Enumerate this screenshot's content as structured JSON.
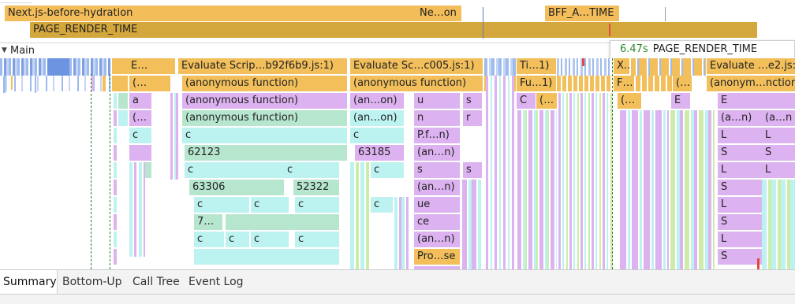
{
  "tooltip": {
    "time": "6.47s",
    "label": "PAGE_RENDER_TIME"
  },
  "main_track_label": "Main",
  "timings": [
    {
      "label": "Next.js-before-hydration"
    },
    {
      "label": "Ne…on"
    },
    {
      "label": "BFF_A…TIME"
    },
    {
      "label": "PAGE_RENDER_TIME"
    }
  ],
  "flame_labels": {
    "r0": [
      "E…",
      "Evaluate Scrip…b92f6b9.js:1)",
      "Evaluate Sc…c005.js:1)",
      "Ti…1)",
      "X…",
      "Evaluate …e2.js:"
    ],
    "r1": [
      "(…",
      "(anonymous function)",
      "(anonymous function)",
      "Fu…1)",
      "F…",
      "(…",
      "(anonym…nction"
    ],
    "r2": [
      "a",
      "(anonymous function)",
      "(an…on)",
      "u",
      "s",
      "C",
      "(…",
      "(…",
      "E",
      "E"
    ],
    "r3": [
      "(…",
      "(anonymous function)",
      "(an…on)",
      "n",
      "r",
      "(a…n)",
      "(a…n"
    ],
    "r4": [
      "c",
      "c",
      "c",
      "P.f…n)",
      "L",
      "L"
    ],
    "r5": [
      "62123",
      "63185",
      "(an…n)",
      "S",
      "S"
    ],
    "r6": [
      "c",
      "c",
      "c",
      "s",
      "s",
      "L",
      "L"
    ],
    "r7": [
      "63306",
      "52322",
      "(an…n)",
      "S"
    ],
    "r8": [
      "c",
      "c",
      "c",
      "c",
      "ue",
      "L"
    ],
    "r9": [
      "7…",
      "ce",
      "S"
    ],
    "r10": [
      "c",
      "c",
      "c",
      "c",
      "(an…n)",
      "L"
    ],
    "r11": [
      "Pro…se",
      "S"
    ]
  },
  "tabs": [
    "Summary",
    "Bottom-Up",
    "Call Tree",
    "Event Log"
  ],
  "colors": {
    "timing": "#f3bd5a",
    "timing_dark": "#d4a73d",
    "eval": "#f2bf5b",
    "purple": "#dcb2f0",
    "teal": "#b7e6cf",
    "cyan": "#bcf2f0",
    "blue": "#9dbbee",
    "lime": "#cdeca8"
  }
}
